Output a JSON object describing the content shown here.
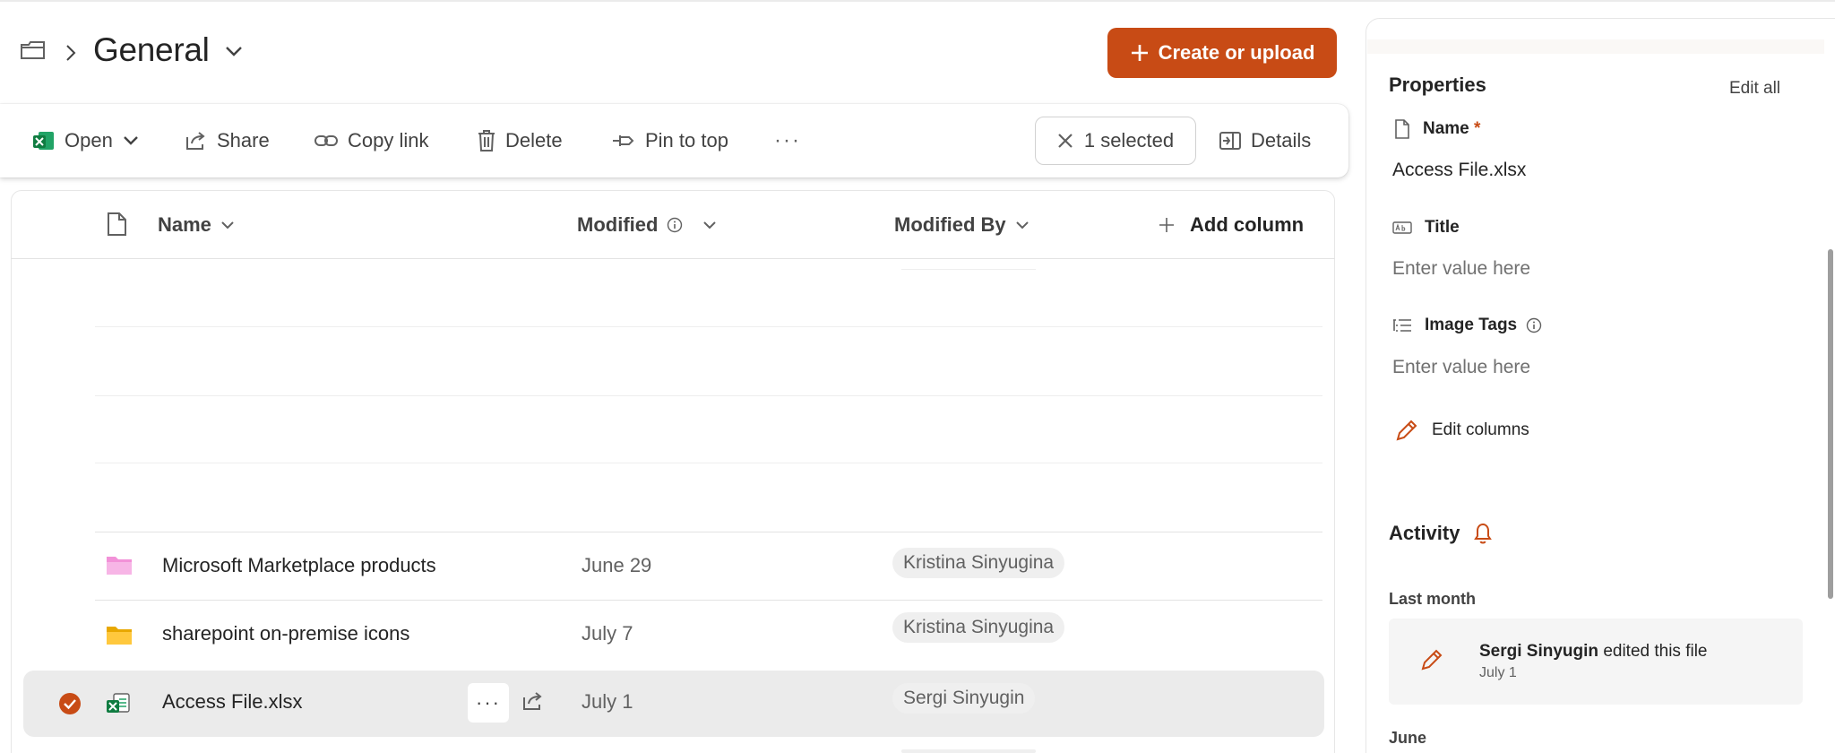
{
  "header": {
    "title": "General",
    "create_label": "Create or upload"
  },
  "toolbar": {
    "open": "Open",
    "share": "Share",
    "copy_link": "Copy link",
    "delete": "Delete",
    "pin_to_top": "Pin to top",
    "more": "···",
    "selected": "1 selected",
    "details": "Details"
  },
  "columns": {
    "name": "Name",
    "modified": "Modified",
    "modified_by": "Modified By",
    "add_column": "Add column"
  },
  "rows": [
    {
      "name": "Microsoft Marketplace products",
      "modified": "June 29",
      "modified_by": "Kristina Sinyugina",
      "type": "folder-pink"
    },
    {
      "name": "sharepoint on-premise icons",
      "modified": "July 7",
      "modified_by": "Kristina Sinyugina",
      "type": "folder-yellow"
    },
    {
      "name": "Access File.xlsx",
      "modified": "July 1",
      "modified_by": "Sergi Sinyugin",
      "type": "excel",
      "selected": true,
      "more": "···"
    }
  ],
  "details": {
    "properties_title": "Properties",
    "edit_all": "Edit all",
    "name_label": "Name",
    "required_mark": "*",
    "name_value": "Access File.xlsx",
    "title_label": "Title",
    "title_placeholder": "Enter value here",
    "image_tags_label": "Image Tags",
    "image_tags_placeholder": "Enter value here",
    "edit_columns": "Edit columns",
    "activity_title": "Activity",
    "last_month": "Last month",
    "activity_user": "Sergi Sinyugin",
    "activity_action": "edited this file",
    "activity_date": "July 1",
    "june": "June"
  },
  "colors": {
    "accent": "#c84b15",
    "selected_row": "#ebebeb",
    "excel_green": "#107c41",
    "folder_pink": "#f291d8",
    "folder_yellow": "#ffc83d"
  }
}
